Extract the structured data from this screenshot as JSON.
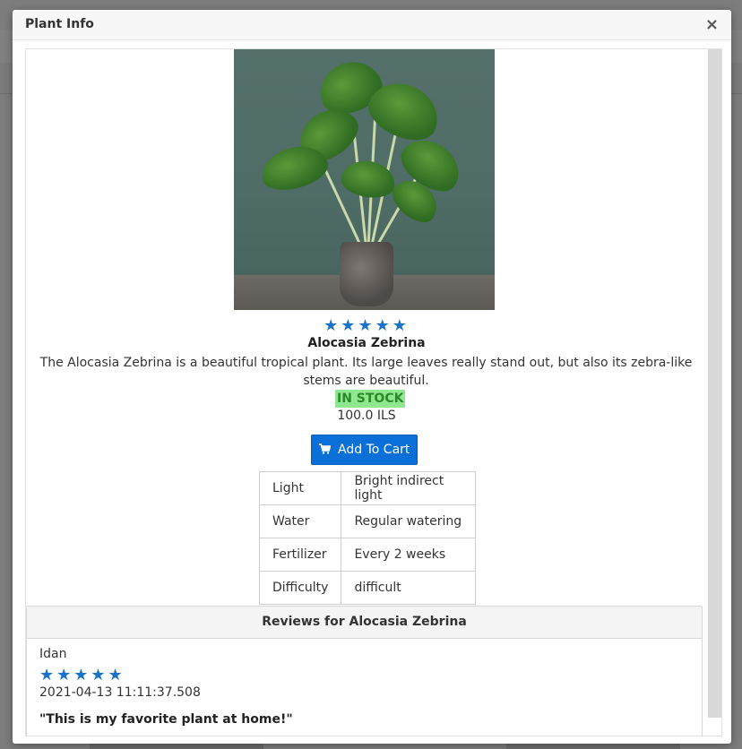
{
  "modal": {
    "title": "Plant Info",
    "close_label": "×"
  },
  "plant": {
    "image_alt": "Alocasia Zebrina plant in a grey pot",
    "rating_stars": "★★★★★",
    "rating_value": 5,
    "name": "Alocasia Zebrina",
    "description": "The Alocasia Zebrina is a beautiful tropical plant. Its large leaves really stand out, but also its zebra-like stems are beautiful.",
    "stock_status": "IN STOCK",
    "price": "100.0 ILS",
    "add_to_cart_label": "Add To Cart",
    "cart_icon": "shopping-cart-icon"
  },
  "care_table": [
    {
      "key": "Light",
      "value": "Bright indirect light"
    },
    {
      "key": "Water",
      "value": "Regular watering"
    },
    {
      "key": "Fertilizer",
      "value": "Every 2 weeks"
    },
    {
      "key": "Difficulty",
      "value": "difficult"
    }
  ],
  "reviews": {
    "header": "Reviews for Alocasia Zebrina",
    "items": [
      {
        "user": "Idan",
        "stars": "★★★★★",
        "rating_value": 5,
        "date": "2021-04-13 11:11:37.508",
        "text": "\"This is my favorite plant at home!\""
      }
    ]
  },
  "colors": {
    "accent": "#0a6fd6",
    "star": "#1a73c8",
    "stock_bg": "#8fe88f",
    "stock_text": "#2a8a2a"
  }
}
